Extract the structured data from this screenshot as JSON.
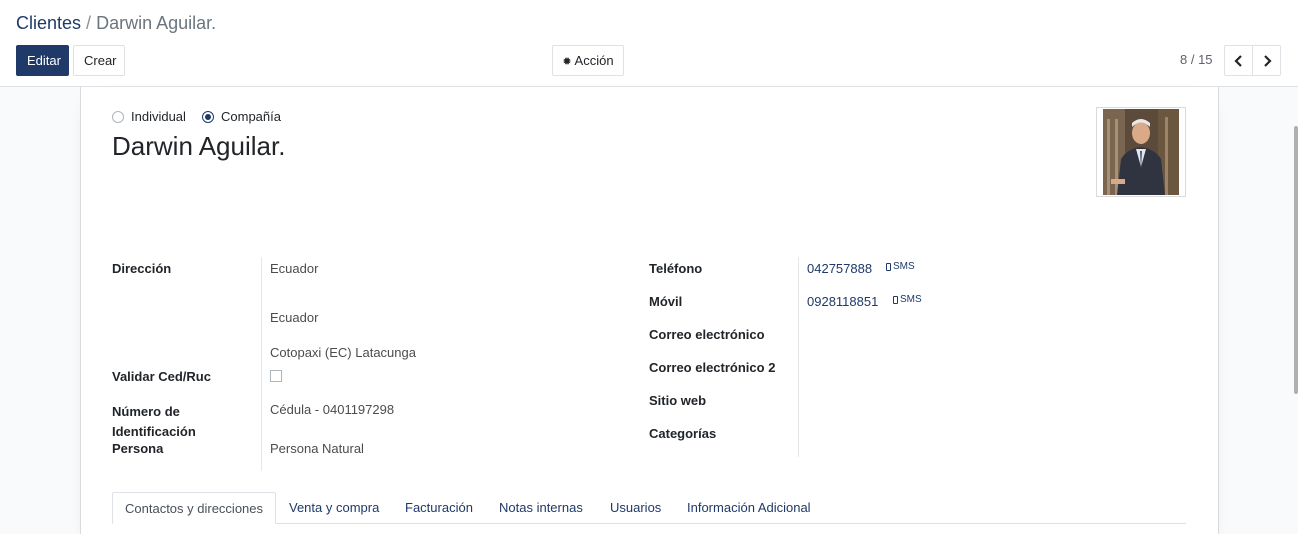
{
  "breadcrumb": {
    "parent": "Clientes",
    "separator": "/",
    "current": "Darwin Aguilar."
  },
  "buttons": {
    "edit": "Editar",
    "create": "Crear",
    "action": "Acción"
  },
  "pager": {
    "value": "8 / 15"
  },
  "type_options": [
    {
      "label": "Individual",
      "checked": false
    },
    {
      "label": "Compañía",
      "checked": true
    }
  ],
  "partner": {
    "name": "Darwin Aguilar."
  },
  "address": {
    "label": "Dirección",
    "country": "Ecuador",
    "country2": "Ecuador",
    "state_city": "Cotopaxi (EC)  Latacunga"
  },
  "validate": {
    "label": "Validar Ced/Ruc",
    "checked": false
  },
  "identification": {
    "label": "Número de Identificación",
    "value": "Cédula - 0401197298"
  },
  "person": {
    "label": "Persona",
    "value": "Persona Natural"
  },
  "contact": {
    "phone_label": "Teléfono",
    "phone": "042757888",
    "mobile_label": "Móvil",
    "mobile": "0928118851",
    "sms": "SMS",
    "email_label": "Correo electrónico",
    "email2_label": "Correo electrónico 2",
    "website_label": "Sitio web",
    "categories_label": "Categorías"
  },
  "tabs": [
    "Contactos y direcciones",
    "Venta y compra",
    "Facturación",
    "Notas internas",
    "Usuarios",
    "Información Adicional"
  ],
  "icons": {
    "action": "gear-icon",
    "prev": "chevron-left-icon",
    "next": "chevron-right-icon",
    "sms": "mobile-phone-icon"
  },
  "colors": {
    "primary": "#1f3a68",
    "background": "#f9fafb"
  }
}
